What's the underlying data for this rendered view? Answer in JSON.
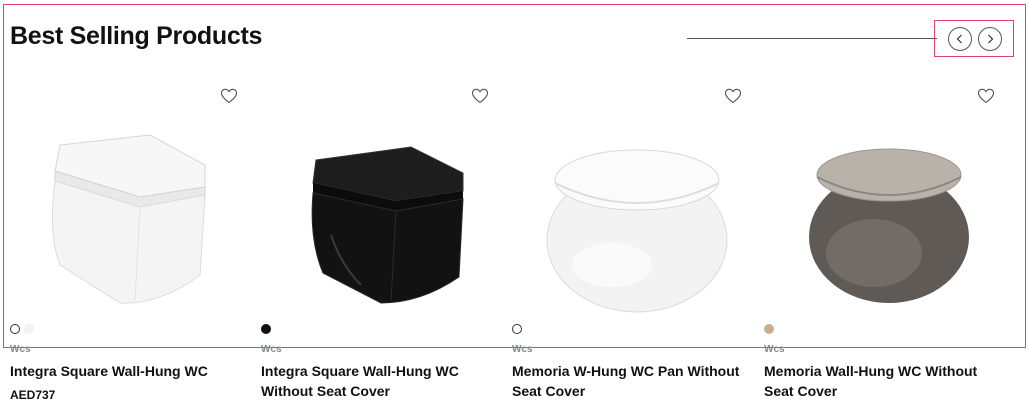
{
  "section": {
    "title": "Best Selling Products"
  },
  "products": [
    {
      "category": "Wcs",
      "name": "Integra Square Wall-Hung WC",
      "price": "AED737",
      "swatches": [
        "#ffffff",
        "#f4f4f4"
      ],
      "body_color": "#f2f2f2",
      "icon": "toilet-image"
    },
    {
      "category": "Wcs",
      "name": "Integra Square Wall-Hung WC Without Seat Cover",
      "price": "",
      "swatches": [
        "#111111"
      ],
      "body_color": "#151515",
      "icon": "toilet-image"
    },
    {
      "category": "Wcs",
      "name": "Memoria W-Hung WC Pan Without Seat Cover",
      "price": "",
      "swatches": [
        "#ffffff"
      ],
      "body_color": "#f0f0f0",
      "icon": "toilet-image"
    },
    {
      "category": "Wcs",
      "name": "Memoria Wall-Hung WC Without Seat Cover",
      "price": "",
      "swatches": [
        "#c8b08e"
      ],
      "body_color": "#6a645e",
      "icon": "toilet-image"
    }
  ],
  "icons": {
    "heart": "heart-icon",
    "prev": "chevron-left-icon",
    "next": "chevron-right-icon"
  },
  "colors": {
    "accent_border": "#e0407a"
  }
}
